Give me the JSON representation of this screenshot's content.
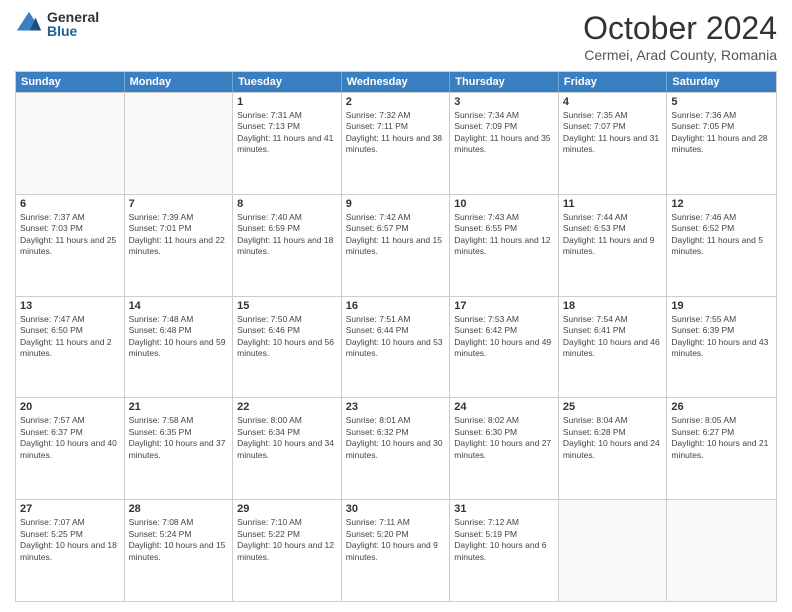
{
  "header": {
    "logo_general": "General",
    "logo_blue": "Blue",
    "month_title": "October 2024",
    "location": "Cermei, Arad County, Romania"
  },
  "days_of_week": [
    "Sunday",
    "Monday",
    "Tuesday",
    "Wednesday",
    "Thursday",
    "Friday",
    "Saturday"
  ],
  "weeks": [
    [
      {
        "day": "",
        "info": ""
      },
      {
        "day": "",
        "info": ""
      },
      {
        "day": "1",
        "info": "Sunrise: 7:31 AM\nSunset: 7:13 PM\nDaylight: 11 hours and 41 minutes."
      },
      {
        "day": "2",
        "info": "Sunrise: 7:32 AM\nSunset: 7:11 PM\nDaylight: 11 hours and 38 minutes."
      },
      {
        "day": "3",
        "info": "Sunrise: 7:34 AM\nSunset: 7:09 PM\nDaylight: 11 hours and 35 minutes."
      },
      {
        "day": "4",
        "info": "Sunrise: 7:35 AM\nSunset: 7:07 PM\nDaylight: 11 hours and 31 minutes."
      },
      {
        "day": "5",
        "info": "Sunrise: 7:36 AM\nSunset: 7:05 PM\nDaylight: 11 hours and 28 minutes."
      }
    ],
    [
      {
        "day": "6",
        "info": "Sunrise: 7:37 AM\nSunset: 7:03 PM\nDaylight: 11 hours and 25 minutes."
      },
      {
        "day": "7",
        "info": "Sunrise: 7:39 AM\nSunset: 7:01 PM\nDaylight: 11 hours and 22 minutes."
      },
      {
        "day": "8",
        "info": "Sunrise: 7:40 AM\nSunset: 6:59 PM\nDaylight: 11 hours and 18 minutes."
      },
      {
        "day": "9",
        "info": "Sunrise: 7:42 AM\nSunset: 6:57 PM\nDaylight: 11 hours and 15 minutes."
      },
      {
        "day": "10",
        "info": "Sunrise: 7:43 AM\nSunset: 6:55 PM\nDaylight: 11 hours and 12 minutes."
      },
      {
        "day": "11",
        "info": "Sunrise: 7:44 AM\nSunset: 6:53 PM\nDaylight: 11 hours and 9 minutes."
      },
      {
        "day": "12",
        "info": "Sunrise: 7:46 AM\nSunset: 6:52 PM\nDaylight: 11 hours and 5 minutes."
      }
    ],
    [
      {
        "day": "13",
        "info": "Sunrise: 7:47 AM\nSunset: 6:50 PM\nDaylight: 11 hours and 2 minutes."
      },
      {
        "day": "14",
        "info": "Sunrise: 7:48 AM\nSunset: 6:48 PM\nDaylight: 10 hours and 59 minutes."
      },
      {
        "day": "15",
        "info": "Sunrise: 7:50 AM\nSunset: 6:46 PM\nDaylight: 10 hours and 56 minutes."
      },
      {
        "day": "16",
        "info": "Sunrise: 7:51 AM\nSunset: 6:44 PM\nDaylight: 10 hours and 53 minutes."
      },
      {
        "day": "17",
        "info": "Sunrise: 7:53 AM\nSunset: 6:42 PM\nDaylight: 10 hours and 49 minutes."
      },
      {
        "day": "18",
        "info": "Sunrise: 7:54 AM\nSunset: 6:41 PM\nDaylight: 10 hours and 46 minutes."
      },
      {
        "day": "19",
        "info": "Sunrise: 7:55 AM\nSunset: 6:39 PM\nDaylight: 10 hours and 43 minutes."
      }
    ],
    [
      {
        "day": "20",
        "info": "Sunrise: 7:57 AM\nSunset: 6:37 PM\nDaylight: 10 hours and 40 minutes."
      },
      {
        "day": "21",
        "info": "Sunrise: 7:58 AM\nSunset: 6:35 PM\nDaylight: 10 hours and 37 minutes."
      },
      {
        "day": "22",
        "info": "Sunrise: 8:00 AM\nSunset: 6:34 PM\nDaylight: 10 hours and 34 minutes."
      },
      {
        "day": "23",
        "info": "Sunrise: 8:01 AM\nSunset: 6:32 PM\nDaylight: 10 hours and 30 minutes."
      },
      {
        "day": "24",
        "info": "Sunrise: 8:02 AM\nSunset: 6:30 PM\nDaylight: 10 hours and 27 minutes."
      },
      {
        "day": "25",
        "info": "Sunrise: 8:04 AM\nSunset: 6:28 PM\nDaylight: 10 hours and 24 minutes."
      },
      {
        "day": "26",
        "info": "Sunrise: 8:05 AM\nSunset: 6:27 PM\nDaylight: 10 hours and 21 minutes."
      }
    ],
    [
      {
        "day": "27",
        "info": "Sunrise: 7:07 AM\nSunset: 5:25 PM\nDaylight: 10 hours and 18 minutes."
      },
      {
        "day": "28",
        "info": "Sunrise: 7:08 AM\nSunset: 5:24 PM\nDaylight: 10 hours and 15 minutes."
      },
      {
        "day": "29",
        "info": "Sunrise: 7:10 AM\nSunset: 5:22 PM\nDaylight: 10 hours and 12 minutes."
      },
      {
        "day": "30",
        "info": "Sunrise: 7:11 AM\nSunset: 5:20 PM\nDaylight: 10 hours and 9 minutes."
      },
      {
        "day": "31",
        "info": "Sunrise: 7:12 AM\nSunset: 5:19 PM\nDaylight: 10 hours and 6 minutes."
      },
      {
        "day": "",
        "info": ""
      },
      {
        "day": "",
        "info": ""
      }
    ]
  ]
}
